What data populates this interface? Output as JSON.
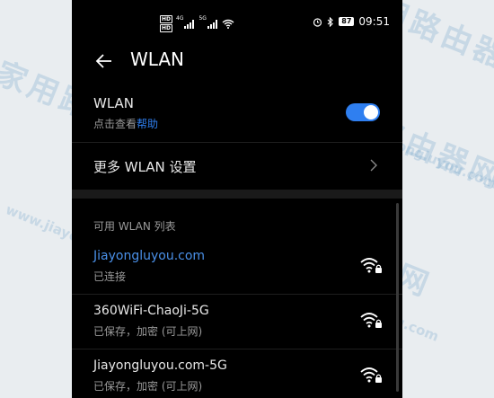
{
  "watermark": {
    "brand_cn": "家用路由器网",
    "brand_en": "www.jiayongluyou.com"
  },
  "statusbar": {
    "hd1": "HD",
    "hd2": "HD",
    "sim1_label": "4G",
    "sim2_label": "5G",
    "battery": "87",
    "time": "09:51"
  },
  "header": {
    "title": "WLAN"
  },
  "wlan_toggle": {
    "label": "WLAN",
    "sub_prefix": "点击查看",
    "sub_link": "帮助",
    "enabled": true,
    "accent": "#2f7ff0"
  },
  "more_settings": {
    "label": "更多 WLAN 设置"
  },
  "networks": {
    "section_title": "可用 WLAN 列表",
    "items": [
      {
        "ssid": "Jiayongluyou.com",
        "status": "已连接",
        "active": true,
        "locked": true
      },
      {
        "ssid": "360WiFi-ChaoJi-5G",
        "status": "已保存，加密 (可上网)",
        "active": false,
        "locked": true
      },
      {
        "ssid": "Jiayongluyou.com-5G",
        "status": "已保存，加密 (可上网)",
        "active": false,
        "locked": true
      }
    ]
  }
}
